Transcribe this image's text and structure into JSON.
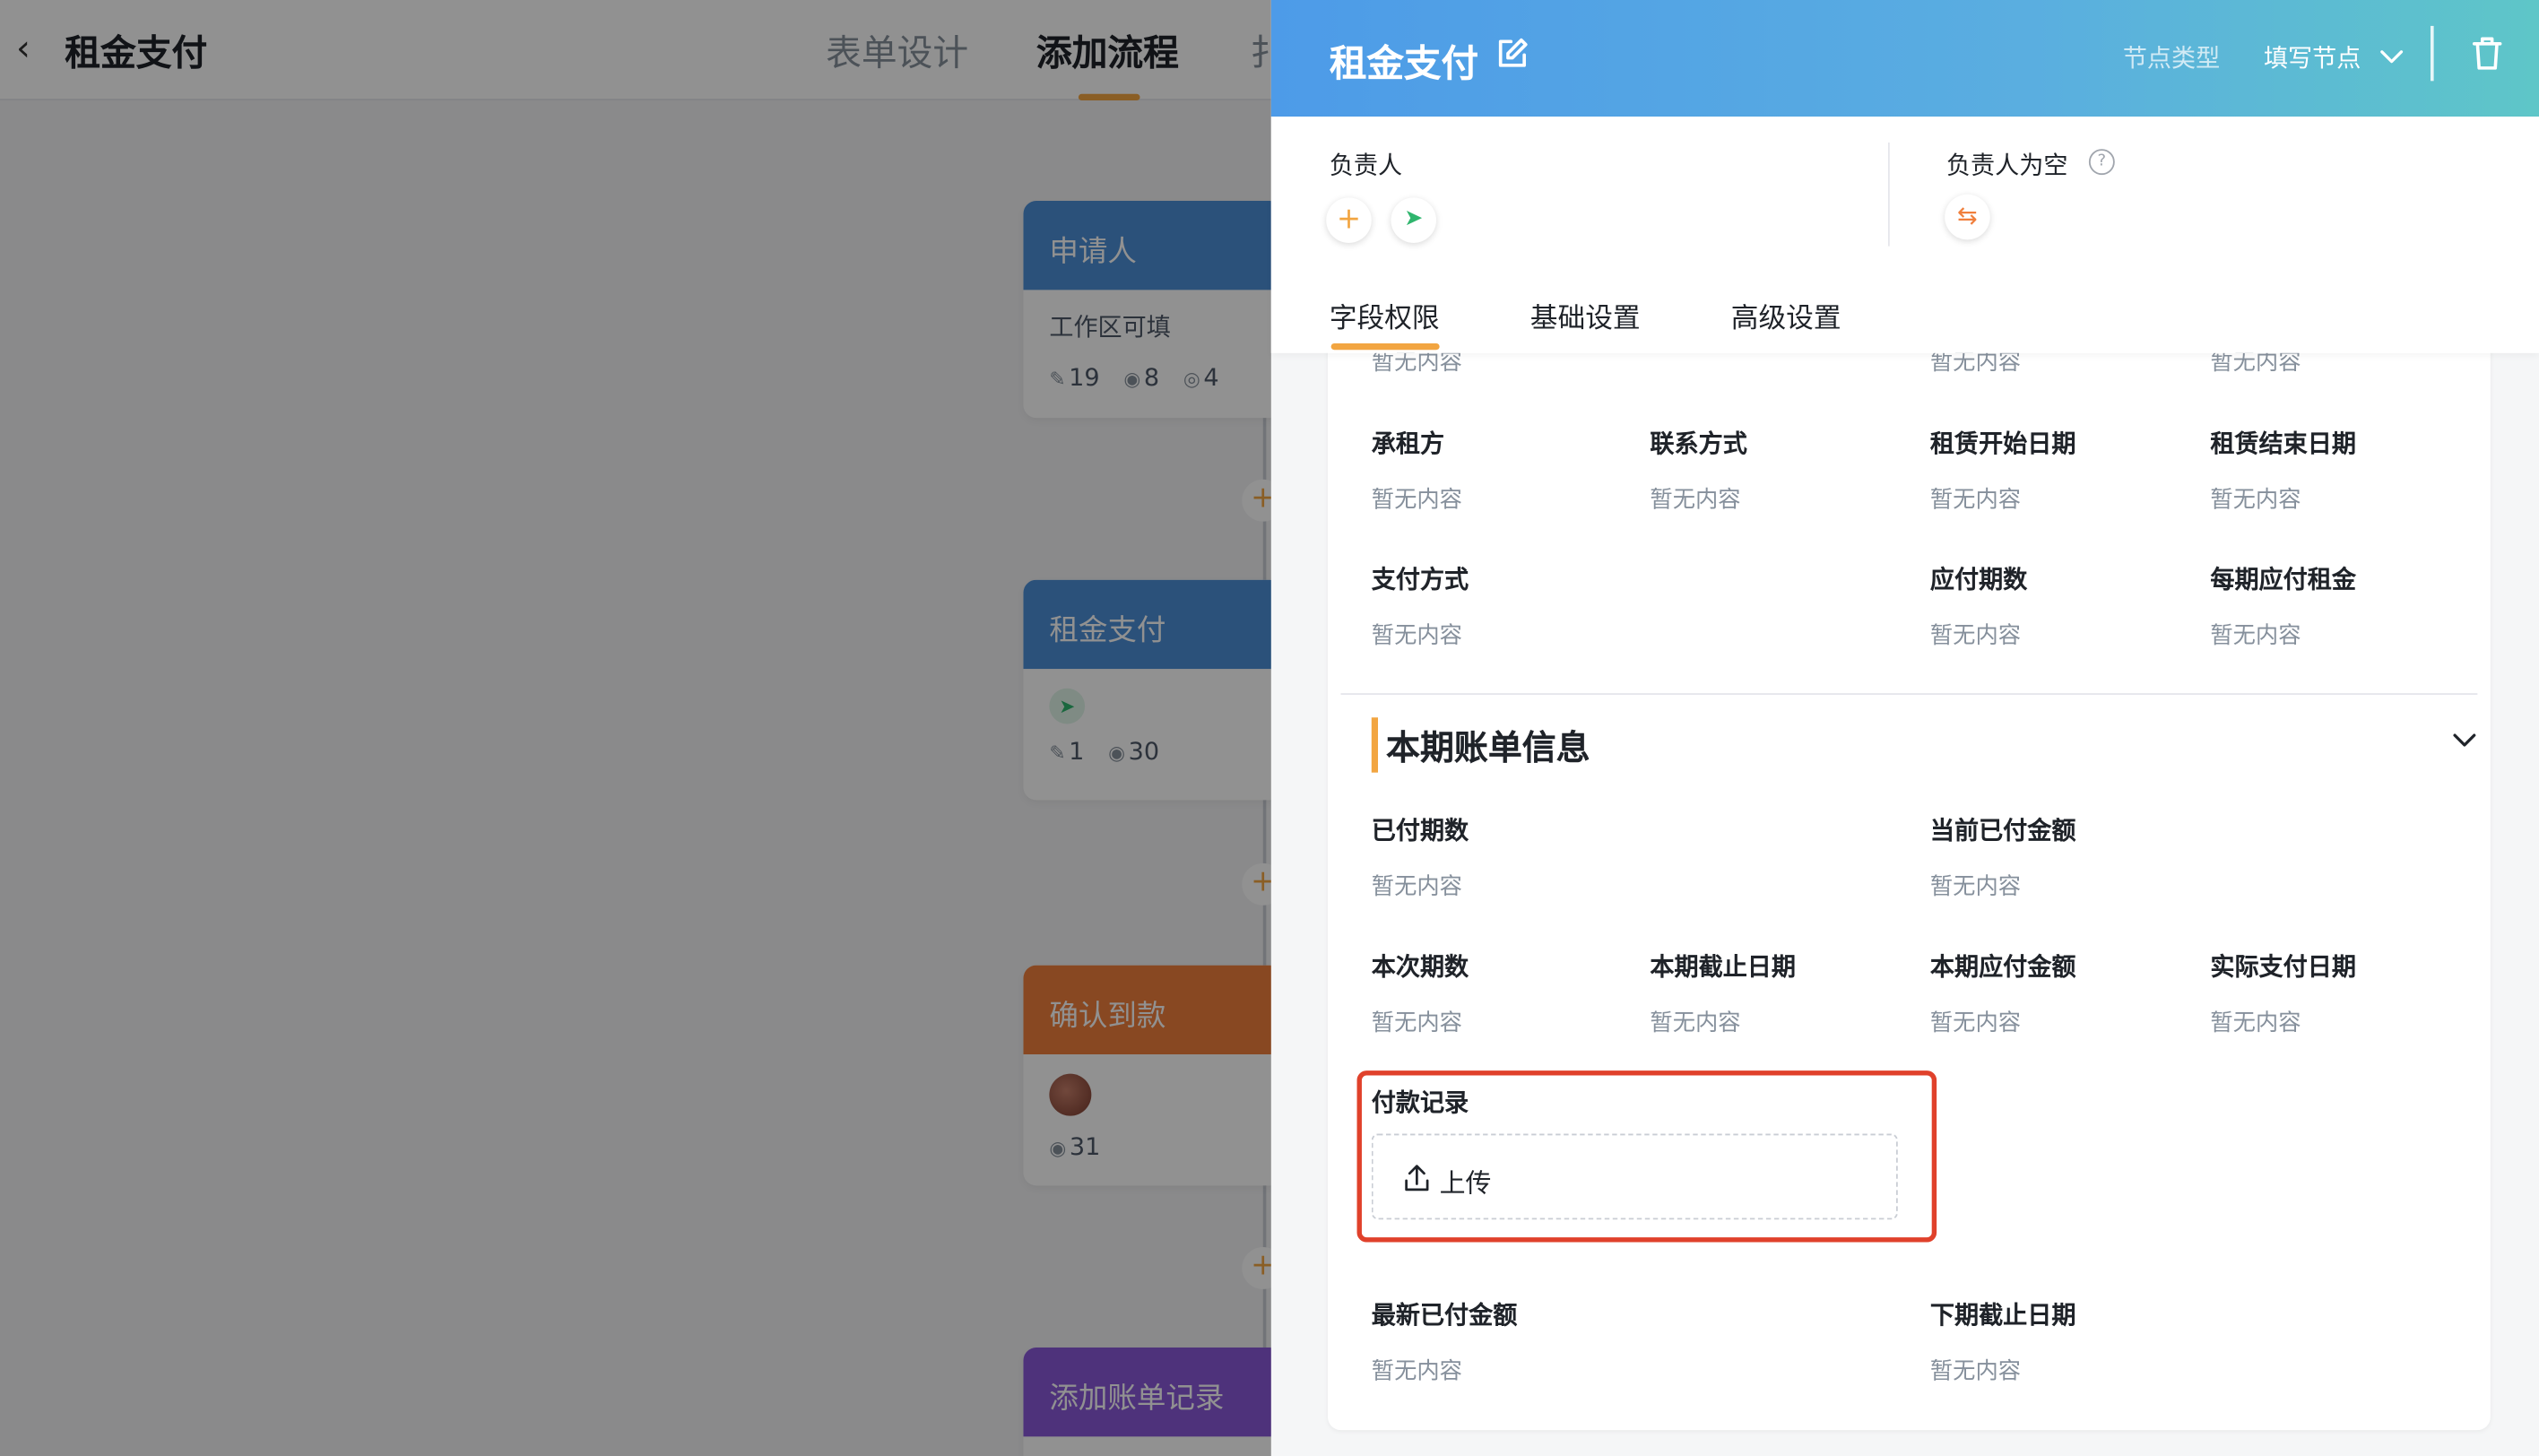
{
  "background": {
    "back_icon": "chevron-left-icon",
    "app_title": "租金支付",
    "tabs": [
      "表单设计",
      "添加流程",
      "扌"
    ],
    "active_tab": "添加流程",
    "nodes": [
      {
        "title": "申请人",
        "color": "#4d8fd6",
        "subtitle": "工作区可填",
        "stats": [
          "19",
          "8",
          "4"
        ]
      },
      {
        "title": "租金支付",
        "color": "#4d8fd6",
        "stats": [
          "1",
          "30"
        ]
      },
      {
        "title": "确认到款",
        "color": "#f07f3c",
        "stats": [
          "31"
        ]
      },
      {
        "title": "添加账单记录",
        "color": "#8a58d8"
      }
    ],
    "plus": "+"
  },
  "drawer": {
    "title": "租金支付",
    "edit_icon": "edit-icon",
    "node_type_label": "节点类型",
    "node_type_value": "填写节点",
    "dropdown_icon": "chevron-down-icon",
    "delete_icon": "trash-icon",
    "assignee_label": "负责人",
    "add_icon": "+",
    "assignee_empty_label": "负责人为空",
    "help_icon": "?",
    "swap_icon": "⇆",
    "tabs": [
      "字段权限",
      "基础设置",
      "高级设置"
    ],
    "active_tab": "字段权限",
    "colors": {
      "accent": "#f2a541",
      "header_start": "#4d9be8",
      "header_end": "#5ec6c8",
      "highlight": "#e0412b"
    }
  },
  "fields_top": {
    "cut_empty": [
      "暂无内容",
      "暂无内容",
      "暂无内容"
    ],
    "row1": [
      {
        "label": "承租方",
        "value": "暂无内容"
      },
      {
        "label": "联系方式",
        "value": "暂无内容"
      },
      {
        "label": "租赁开始日期",
        "value": "暂无内容"
      },
      {
        "label": "租赁结束日期",
        "value": "暂无内容"
      }
    ],
    "row2": [
      {
        "label": "支付方式",
        "value": "暂无内容"
      },
      {
        "label": "应付期数",
        "value": "暂无内容"
      },
      {
        "label": "每期应付租金",
        "value": "暂无内容"
      }
    ]
  },
  "section": {
    "title": "本期账单信息",
    "row1": [
      {
        "label": "已付期数",
        "value": "暂无内容"
      },
      {
        "label": "当前已付金额",
        "value": "暂无内容"
      }
    ],
    "row2": [
      {
        "label": "本次期数",
        "value": "暂无内容"
      },
      {
        "label": "本期截止日期",
        "value": "暂无内容"
      },
      {
        "label": "本期应付金额",
        "value": "暂无内容"
      },
      {
        "label": "实际支付日期",
        "value": "暂无内容"
      }
    ],
    "payment_record": {
      "label": "付款记录",
      "upload_label": "上传",
      "upload_icon": "upload-icon"
    },
    "row3": [
      {
        "label": "最新已付金额",
        "value": "暂无内容"
      },
      {
        "label": "下期截止日期",
        "value": "暂无内容"
      }
    ]
  }
}
